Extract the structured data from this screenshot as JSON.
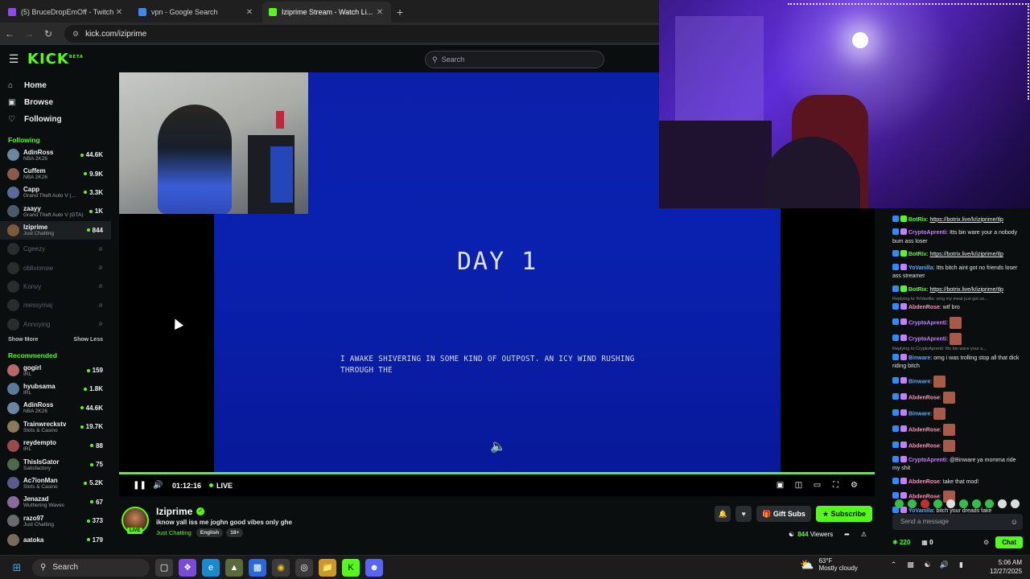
{
  "browser": {
    "tabs": [
      {
        "title": "(5) BruceDropEmOff - Twitch",
        "color": "#9146ff"
      },
      {
        "title": "vpn - Google Search",
        "color": "#4285f4"
      },
      {
        "title": "Iziprime Stream - Watch Li...",
        "color": "#53fc18"
      }
    ],
    "url": "kick.com/iziprime"
  },
  "header": {
    "logo": "KICK",
    "logo_sup": "BETA",
    "search_placeholder": "Search"
  },
  "sidebar": {
    "nav": [
      {
        "label": "Home",
        "icon": "home-icon"
      },
      {
        "label": "Browse",
        "icon": "browse-icon"
      },
      {
        "label": "Following",
        "icon": "heart-icon"
      }
    ],
    "following_title": "Following",
    "following": [
      {
        "name": "AdinRoss",
        "category": "NBA 2K26",
        "viewers": "44.6K",
        "online": true,
        "color": "#6a86a0"
      },
      {
        "name": "Cuffem",
        "category": "NBA 2K26",
        "viewers": "9.9K",
        "online": true,
        "color": "#8a5a4a"
      },
      {
        "name": "Capp",
        "category": "Grand Theft Auto V (...",
        "viewers": "3.3K",
        "online": true,
        "color": "#5a6a9a"
      },
      {
        "name": "zaayy",
        "category": "Grand Theft Auto V (GTA)",
        "viewers": "1K",
        "online": true,
        "color": "#4a5a6a"
      },
      {
        "name": "Iziprime",
        "category": "Just Chatting",
        "viewers": "844",
        "online": true,
        "selected": true,
        "color": "#7a5a3a"
      },
      {
        "name": "Cgeezy",
        "viewers": "",
        "online": false,
        "color": "#666"
      },
      {
        "name": "oblivionsw",
        "viewers": "",
        "online": false,
        "color": "#666"
      },
      {
        "name": "Konvy",
        "viewers": "",
        "online": false,
        "color": "#666"
      },
      {
        "name": "messymaj",
        "viewers": "",
        "online": false,
        "color": "#666"
      },
      {
        "name": "Annoying",
        "viewers": "",
        "online": false,
        "color": "#666"
      }
    ],
    "show_more": "Show More",
    "show_less": "Show Less",
    "recommended_title": "Recommended",
    "recommended": [
      {
        "name": "gogirl",
        "category": "IRL",
        "viewers": "159",
        "color": "#b56a6a"
      },
      {
        "name": "hyubsama",
        "category": "IRL",
        "viewers": "1.8K",
        "color": "#5a7a9a"
      },
      {
        "name": "AdinRoss",
        "category": "NBA 2K26",
        "viewers": "44.6K",
        "color": "#6a86a0"
      },
      {
        "name": "Trainwreckstv",
        "category": "Slots & Casino",
        "viewers": "19.7K",
        "color": "#8a7a5a"
      },
      {
        "name": "reydempto",
        "category": "IRL",
        "viewers": "88",
        "color": "#9a4a4a"
      },
      {
        "name": "ThisIsGator",
        "category": "Satisfactory",
        "viewers": "75",
        "color": "#4a6a4a"
      },
      {
        "name": "Ac7ionMan",
        "category": "Slots & Casino",
        "viewers": "5.2K",
        "color": "#5a5a8a"
      },
      {
        "name": "Jenazad",
        "category": "Wuthering Waves",
        "viewers": "67",
        "color": "#8a6a9a"
      },
      {
        "name": "razo97",
        "category": "Just Chatting",
        "viewers": "373",
        "color": "#6a6a6a"
      },
      {
        "name": "aatoka",
        "category": "",
        "viewers": "179",
        "color": "#7a6a5a"
      }
    ]
  },
  "player": {
    "game_title": "DAY 1",
    "game_text": "I AWAKE SHIVERING IN SOME KIND OF OUTPOST. AN ICY WIND RUSHING THROUGH THE",
    "time": "01:12:16",
    "live": "LIVE",
    "progress": 1.0
  },
  "stream": {
    "name": "Iziprime",
    "title": "iknow yall iss me joghn good vibes only ghe",
    "category": "Just Chatting",
    "tags": [
      "English",
      "18+"
    ],
    "live_badge": "LIVE",
    "gift_label": "Gift Subs",
    "subscribe_label": "Subscribe",
    "viewers": "844",
    "viewers_label": "Viewers"
  },
  "chat": {
    "messages": [
      {
        "user": "BotRix",
        "color": "#53fc18",
        "text": "",
        "link": "https://botrix.live/k/iziprime/tlp"
      },
      {
        "user": "CryptoAprenti",
        "color": "#c77dff",
        "text": "Itts bin ware your a nobody bum ass loser"
      },
      {
        "user": "BotRix",
        "color": "#53fc18",
        "text": "",
        "link": "https://botrix.live/k/iziprime/tlp"
      },
      {
        "user": "YoVanilla",
        "color": "#5aa9ff",
        "text": "Itts bitch aint got no friends loser ass streamer"
      },
      {
        "user": "BotRix",
        "color": "#53fc18",
        "text": "",
        "link": "https://botrix.live/k/iziprime/tlp"
      },
      {
        "reply": "Replying to YoVanilla: omg my meat just got so..."
      },
      {
        "user": "AbdenRose",
        "color": "#ff8fb3",
        "text": "wtf bro"
      },
      {
        "user": "CryptoAprenti",
        "color": "#c77dff",
        "text": "",
        "emote": true
      },
      {
        "user": "CryptoAprenti",
        "color": "#c77dff",
        "text": "",
        "emote": true
      },
      {
        "reply": "Replying to CryptoAprenti: Itts bin ware your a..."
      },
      {
        "user": "Binware",
        "color": "#5aa9ff",
        "text": "omg i was trolling stop all that dick riding bitch"
      },
      {
        "user": "Binware",
        "color": "#5aa9ff",
        "text": "",
        "emote": true
      },
      {
        "user": "AbdenRose",
        "color": "#ff8fb3",
        "text": "",
        "emote": true
      },
      {
        "user": "Binware",
        "color": "#5aa9ff",
        "text": "",
        "emote": true
      },
      {
        "user": "AbdenRose",
        "color": "#ff8fb3",
        "text": "",
        "emote": true
      },
      {
        "user": "AbdenRose",
        "color": "#ff8fb3",
        "text": "",
        "emote": true
      },
      {
        "user": "CryptoAprenti",
        "color": "#c77dff",
        "text": "@Binware ya momma ride my shit"
      },
      {
        "user": "AbdenRose",
        "color": "#ff8fb3",
        "text": "take that mod!"
      },
      {
        "user": "AbdenRose",
        "color": "#ff8fb3",
        "text": "",
        "emote": true
      },
      {
        "user": "YoVanilla",
        "color": "#5aa9ff",
        "text": "bitch your dreads fake"
      }
    ],
    "input_placeholder": "Send a message",
    "points": "220",
    "count": "0",
    "chat_button": "Chat"
  },
  "taskbar": {
    "search": "Search",
    "weather_temp": "63°F",
    "weather_desc": "Mostly cloudy",
    "time": "5:06 AM",
    "date": "12/27/2025"
  }
}
